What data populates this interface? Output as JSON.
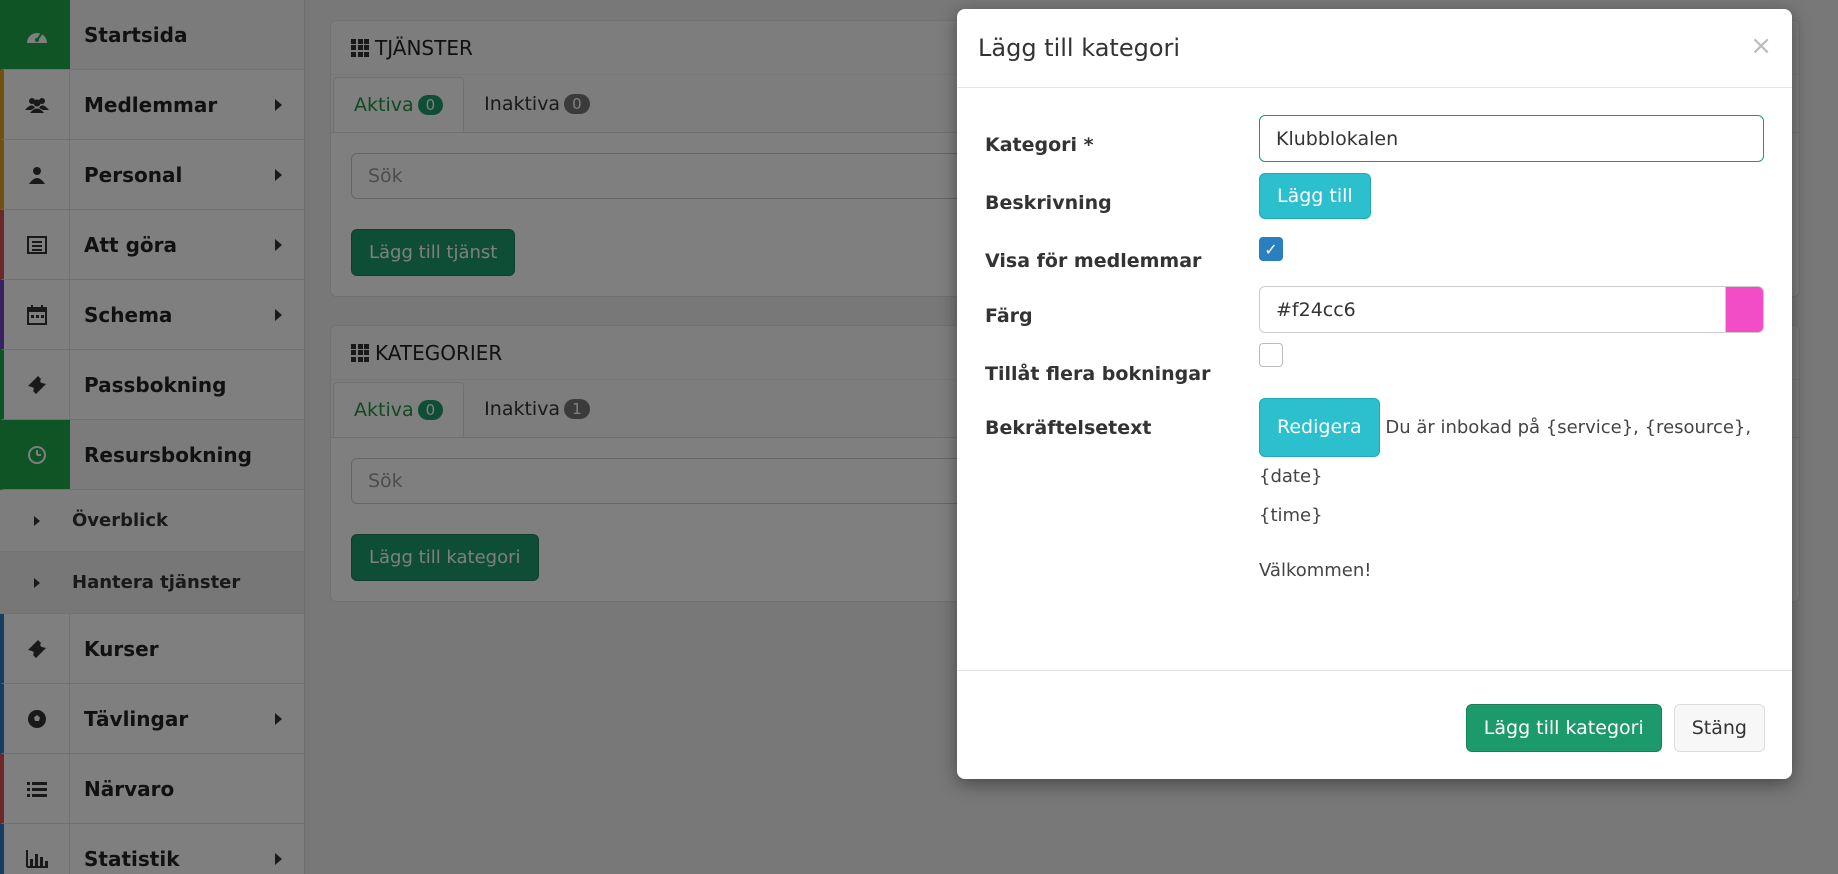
{
  "sidebar": {
    "items": [
      {
        "label": "Startsida",
        "icon": "dashboard-icon",
        "active": true,
        "accent": "#1ea84a"
      },
      {
        "label": "Medlemmar",
        "icon": "users-icon",
        "caret": true,
        "accent": "#e8a020"
      },
      {
        "label": "Personal",
        "icon": "user-icon",
        "caret": true,
        "accent": "#e8a020"
      },
      {
        "label": "Att göra",
        "icon": "list-icon",
        "caret": true,
        "accent": "#d9534f"
      },
      {
        "label": "Schema",
        "icon": "calendar-icon",
        "caret": true,
        "accent": "#6f42c1"
      },
      {
        "label": "Passbokning",
        "icon": "ticket-icon",
        "accent": "#1ea84a"
      },
      {
        "label": "Resursbokning",
        "icon": "clock-icon",
        "active": true,
        "accent": "#1ea84a"
      }
    ],
    "sub_items": [
      {
        "label": "Överblick"
      },
      {
        "label": "Hantera tjänster",
        "current": true
      }
    ],
    "items_bottom": [
      {
        "label": "Kurser",
        "icon": "ticket-icon",
        "accent": "#2a7fc1"
      },
      {
        "label": "Tävlingar",
        "icon": "soccer-ball-icon",
        "caret": true,
        "accent": "#2a7fc1"
      },
      {
        "label": "Närvaro",
        "icon": "list-icon",
        "accent": "#d9534f"
      },
      {
        "label": "Statistik",
        "icon": "bar-chart-icon",
        "caret": true,
        "accent": "#2a7fc1"
      }
    ]
  },
  "services_panel": {
    "title": "TJÄNSTER",
    "tabs": [
      {
        "label": "Aktiva",
        "count": "0",
        "active": true
      },
      {
        "label": "Inaktiva",
        "count": "0"
      }
    ],
    "search_placeholder": "Sök",
    "add_button": "Lägg till tjänst"
  },
  "categories_panel": {
    "title": "KATEGORIER",
    "tabs": [
      {
        "label": "Aktiva",
        "count": "0",
        "active": true
      },
      {
        "label": "Inaktiva",
        "count": "1"
      }
    ],
    "search_placeholder": "Sök",
    "add_button": "Lägg till kategori"
  },
  "modal": {
    "title": "Lägg till kategori",
    "close": "×",
    "fields": {
      "category_label": "Kategori *",
      "category_value": "Klubblokalen",
      "description_label": "Beskrivning",
      "description_button": "Lägg till",
      "show_members_label": "Visa för medlemmar",
      "show_members_checked": true,
      "color_label": "Färg",
      "color_value": "#f24cc6",
      "allow_multiple_label": "Tillåt flera bokningar",
      "allow_multiple_checked": false,
      "confirm_label": "Bekräftelsetext",
      "confirm_button": "Redigera",
      "confirm_text_line1": "Du är inbokad på {service}, {resource}, {date}",
      "confirm_text_line2": "{time}",
      "confirm_text_line3": "Välkommen!"
    },
    "footer": {
      "submit": "Lägg till kategori",
      "close": "Stäng"
    }
  },
  "check_glyph": "✓"
}
